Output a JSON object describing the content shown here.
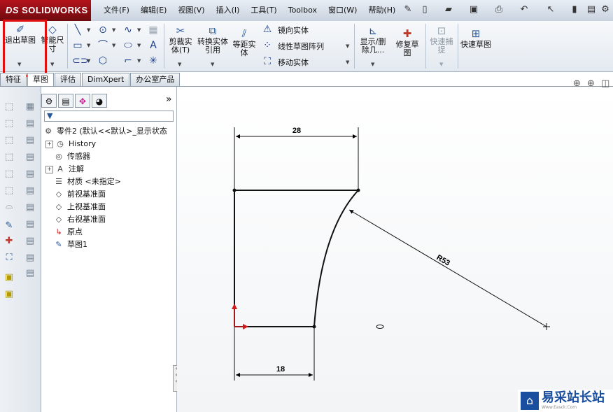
{
  "app": {
    "logo_text": "SOLIDWORKS",
    "logo_prefix": "DS"
  },
  "menu": [
    "文件(F)",
    "编辑(E)",
    "视图(V)",
    "插入(I)",
    "工具(T)",
    "Toolbox",
    "窗口(W)",
    "帮助(H)"
  ],
  "ribbon": {
    "exit_sketch": "退出草图",
    "smart_dimension": "智能尺寸",
    "trim": "剪裁实体(T)",
    "convert": "转换实体引用",
    "offset": "等距实体",
    "mirror": "镜向实体",
    "linear_pattern": "线性草图阵列",
    "move": "移动实体",
    "show_delete": "显示/删除几...",
    "repair": "修复草图",
    "quick_snap": "快速捕捉",
    "rapid_sketch": "快速草图"
  },
  "tabs": [
    "特征",
    "草图",
    "评估",
    "DimXpert",
    "办公室产品"
  ],
  "active_tab": "草图",
  "tree": {
    "root": "零件2 (默认<<默认>_显示状态",
    "items": [
      {
        "label": "History",
        "icon": "history-icon",
        "expandable": true
      },
      {
        "label": "传感器",
        "icon": "sensor-icon",
        "expandable": false
      },
      {
        "label": "注解",
        "icon": "annotation-icon",
        "expandable": true
      },
      {
        "label": "材质 <未指定>",
        "icon": "material-icon",
        "expandable": false
      },
      {
        "label": "前视基准面",
        "icon": "plane-icon",
        "expandable": false
      },
      {
        "label": "上视基准面",
        "icon": "plane-icon",
        "expandable": false
      },
      {
        "label": "右视基准面",
        "icon": "plane-icon",
        "expandable": false
      },
      {
        "label": "原点",
        "icon": "origin-icon",
        "expandable": false
      },
      {
        "label": "草图1",
        "icon": "sketch-icon",
        "expandable": false
      }
    ]
  },
  "sketch": {
    "dim_top": "28",
    "dim_bottom": "18",
    "dim_radius": "R53"
  },
  "watermark": {
    "text": "易采站长站",
    "sub": "Www.Easck.Com"
  },
  "colors": {
    "highlight": "#e01010",
    "accent": "#2b5797",
    "origin": "#d11a1a"
  }
}
